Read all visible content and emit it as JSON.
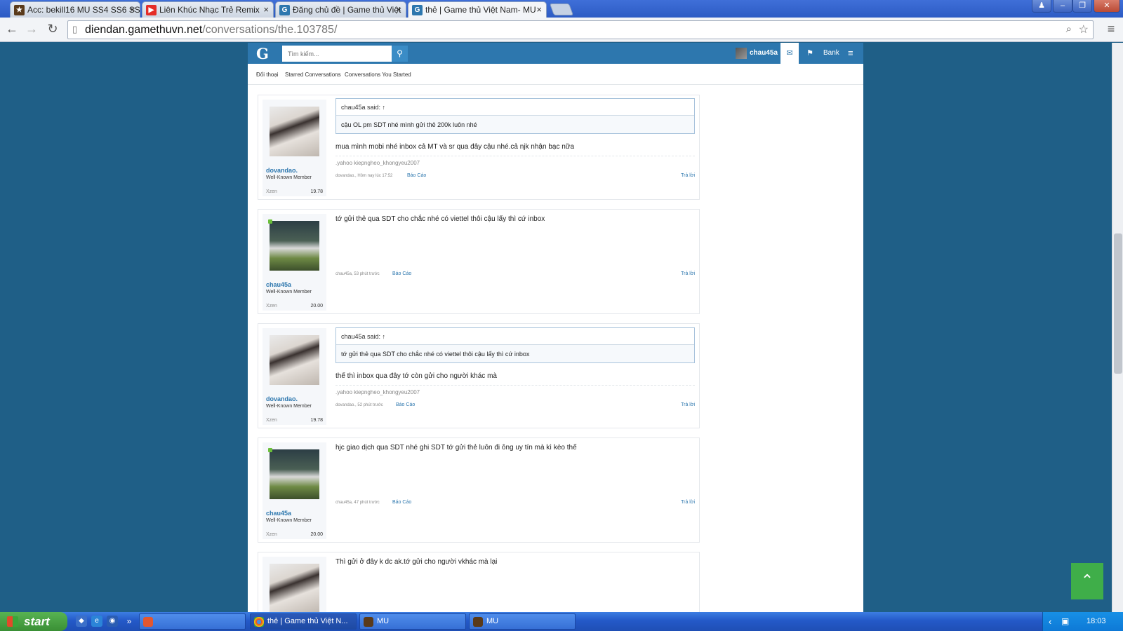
{
  "browser": {
    "tabs": [
      {
        "label": "Acc: bekill16 MU SS4 SS6 SS8",
        "favicon": "game-icon",
        "color": "#5a3a1a"
      },
      {
        "label": "Liên Khúc Nhạc Trẻ Remix",
        "favicon": "youtube-icon",
        "color": "#e52d27"
      },
      {
        "label": "Đăng chủ đề | Game thủ Việt",
        "favicon": "gamethuvn-icon",
        "color": "#2d77ae"
      },
      {
        "label": "thẻ | Game thủ Việt Nam- MU",
        "favicon": "gamethuvn-icon",
        "color": "#2d77ae"
      }
    ],
    "url_domain": "diendan.gamethuvn.net",
    "url_path": "/conversations/the.103785/"
  },
  "site": {
    "logo": "G",
    "search_placeholder": "Tìm kiếm...",
    "username": "chau45a",
    "bank_label": "Bank",
    "subnav": [
      "Đối thoại",
      "Starred Conversations",
      "Conversations You Started"
    ]
  },
  "posts": [
    {
      "author": "dovandao.",
      "title": "Well-Known Member",
      "xzen_label": "Xzen",
      "xzen": "19.78",
      "quote_head": "chau45a said: ↑",
      "quote_body": "cậu OL pm SDT nhé mình gửi thẻ 200k luôn nhé",
      "message": "mua mình mobi nhé inbox cả MT và sr qua đây cậu nhé.cả njk nhận bạc nữa",
      "signature": ".yahoo kiepngheo_khongyeu2007",
      "meta": "dovandao., Hôm nay lúc 17:52",
      "report": "Báo Cáo",
      "reply": "Trả lời"
    },
    {
      "author": "chau45a",
      "title": "Well-Known Member",
      "xzen_label": "Xzen",
      "xzen": "20.00",
      "message": "tớ gửi thẻ qua SDT cho chắc nhé có viettel thôi cậu lấy thì cứ inbox",
      "meta": "chau45a, 53 phút trước",
      "report": "Báo Cáo",
      "reply": "Trả lời"
    },
    {
      "author": "dovandao.",
      "title": "Well-Known Member",
      "xzen_label": "Xzen",
      "xzen": "19.78",
      "quote_head": "chau45a said: ↑",
      "quote_body": "tớ gửi thẻ qua SDT cho chắc nhé có viettel thôi cậu lấy thì cứ inbox",
      "message": "thế thì inbox qua đây tớ còn gửi cho người khác mà",
      "signature": ".yahoo kiepngheo_khongyeu2007",
      "meta": "dovandao., 52 phút trước",
      "report": "Báo Cáo",
      "reply": "Trả lời"
    },
    {
      "author": "chau45a",
      "title": "Well-Known Member",
      "xzen_label": "Xzen",
      "xzen": "20.00",
      "message": "hjc giao dịch qua SDT nhé ghi SDT tớ gửi thẻ luôn đi ông uy tín mà kì kèo thế",
      "meta": "chau45a, 47 phút trước",
      "report": "Báo Cáo",
      "reply": "Trả lời"
    },
    {
      "message": "Thì gửi ở đây k dc ak.tớ gửi cho người vkhác mà lại"
    }
  ],
  "taskbar": {
    "start": "start",
    "buttons": [
      "thẻ | Game thủ Việt N...",
      "MU",
      "MU"
    ],
    "clock": "18:03"
  }
}
